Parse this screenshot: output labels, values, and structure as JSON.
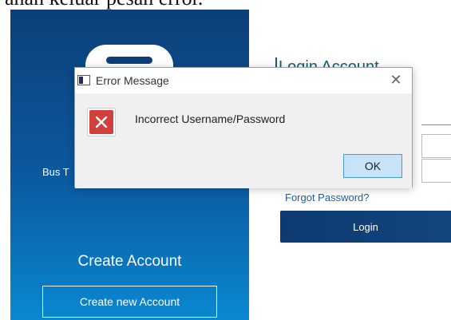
{
  "background_text": "anan keluar pesan error.",
  "left_panel": {
    "bus_label": "Bus T",
    "create_title": "Create Account",
    "create_button_label": "Create new Account"
  },
  "right_panel": {
    "login_title": "Login Account",
    "forgot_password": "Forgot Password?",
    "login_button_label": "Login"
  },
  "dialog": {
    "title": "Error Message",
    "close_glyph": "✕",
    "message": "Incorrect Username/Password",
    "ok_label": "OK"
  },
  "colors": {
    "panel_top": "#0c3f78",
    "panel_bottom": "#0a88d2",
    "error_red": "#d1403c",
    "ok_button": "#c6e3f7",
    "login_title": "#0f5f6f"
  }
}
